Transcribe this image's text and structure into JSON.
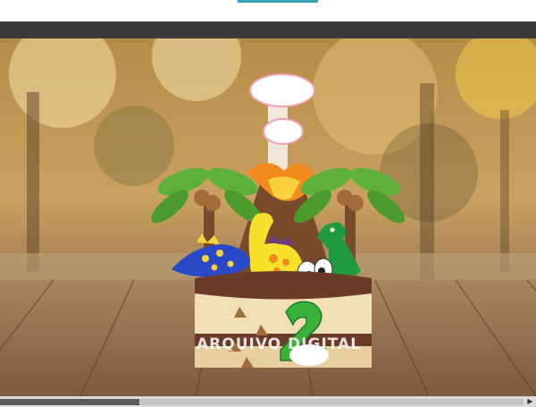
{
  "watermark": "ARQUIVO DIGITAL",
  "scroll": {
    "position": 0.27
  },
  "colors": {
    "frame": "#3a3a3a",
    "accent": "#3aa0b8",
    "cake_chocolate": "#6b3b2a",
    "cake_cream": "#f1dfb8"
  },
  "icons": {
    "scroll_right": "triangle-right-icon"
  }
}
